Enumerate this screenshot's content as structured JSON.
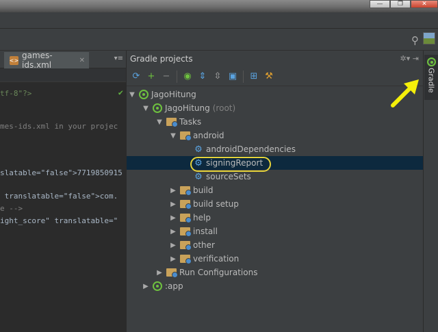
{
  "window": {
    "minimize_label": "—",
    "restore_label": "❐",
    "close_label": "✕"
  },
  "editor": {
    "tab": {
      "label": "games-ids.xml",
      "close": "✕",
      "menu": "▾≡"
    },
    "lines": [
      {
        "text": "tf-8\"?>",
        "kind": "str"
      },
      {
        "text": "mes-ids.xml in your projec",
        "kind": "com"
      },
      {
        "text": "slatable=\"false\">7719850915",
        "kind": "val"
      },
      {
        "text": " translatable=\"false\">com.",
        "kind": "val"
      },
      {
        "text": "e -->",
        "kind": "com"
      },
      {
        "text": "ight_score\" translatable=\"",
        "kind": "val"
      }
    ]
  },
  "gradle_panel": {
    "title": "Gradle projects",
    "header_icons": "✲▾ ⇥",
    "toolbar": [
      {
        "name": "refresh-icon",
        "glyph": "⟳",
        "color": "#5aa3e0"
      },
      {
        "name": "add-icon",
        "glyph": "+",
        "color": "#6ec13f"
      },
      {
        "name": "remove-icon",
        "glyph": "−",
        "color": "#888888"
      },
      {
        "name": "execute-task-icon",
        "glyph": "◉",
        "color": "#6ec13f"
      },
      {
        "name": "expand-all-icon",
        "glyph": "⇕",
        "color": "#5aa3e0"
      },
      {
        "name": "collapse-all-icon",
        "glyph": "⇳",
        "color": "#aaaaaa"
      },
      {
        "name": "link-icon",
        "glyph": "▣",
        "color": "#5aa3e0"
      },
      {
        "name": "group-tasks-icon",
        "glyph": "⊞",
        "color": "#5aa3e0"
      },
      {
        "name": "settings-icon",
        "glyph": "⚒",
        "color": "#e0a030"
      }
    ],
    "tree": [
      {
        "label": "JagoHitung",
        "level": 0,
        "arrow": "▼",
        "icon": "gradle"
      },
      {
        "label": "JagoHitung",
        "suffix": "(root)",
        "level": 1,
        "arrow": "▼",
        "icon": "gradle"
      },
      {
        "label": "Tasks",
        "level": 2,
        "arrow": "▼",
        "icon": "folder"
      },
      {
        "label": "android",
        "level": 3,
        "arrow": "▼",
        "icon": "folder"
      },
      {
        "label": "androidDependencies",
        "level": 4,
        "arrow": "",
        "icon": "gear"
      },
      {
        "label": "signingReport",
        "level": 4,
        "arrow": "",
        "icon": "gear",
        "selected": true
      },
      {
        "label": "sourceSets",
        "level": 4,
        "arrow": "",
        "icon": "gear"
      },
      {
        "label": "build",
        "level": 3,
        "arrow": "▶",
        "icon": "folder"
      },
      {
        "label": "build setup",
        "level": 3,
        "arrow": "▶",
        "icon": "folder"
      },
      {
        "label": "help",
        "level": 3,
        "arrow": "▶",
        "icon": "folder"
      },
      {
        "label": "install",
        "level": 3,
        "arrow": "▶",
        "icon": "folder"
      },
      {
        "label": "other",
        "level": 3,
        "arrow": "▶",
        "icon": "folder"
      },
      {
        "label": "verification",
        "level": 3,
        "arrow": "▶",
        "icon": "folder"
      },
      {
        "label": "Run Configurations",
        "level": 2,
        "arrow": "▶",
        "icon": "folder"
      },
      {
        "label": ":app",
        "level": 1,
        "arrow": "▶",
        "icon": "gradle"
      }
    ]
  },
  "right_strip": {
    "tab_label": "Gradle"
  },
  "colors": {
    "highlight": "#e6d23a",
    "annotation_arrow": "#f5f00a",
    "selection": "#0d293e"
  }
}
